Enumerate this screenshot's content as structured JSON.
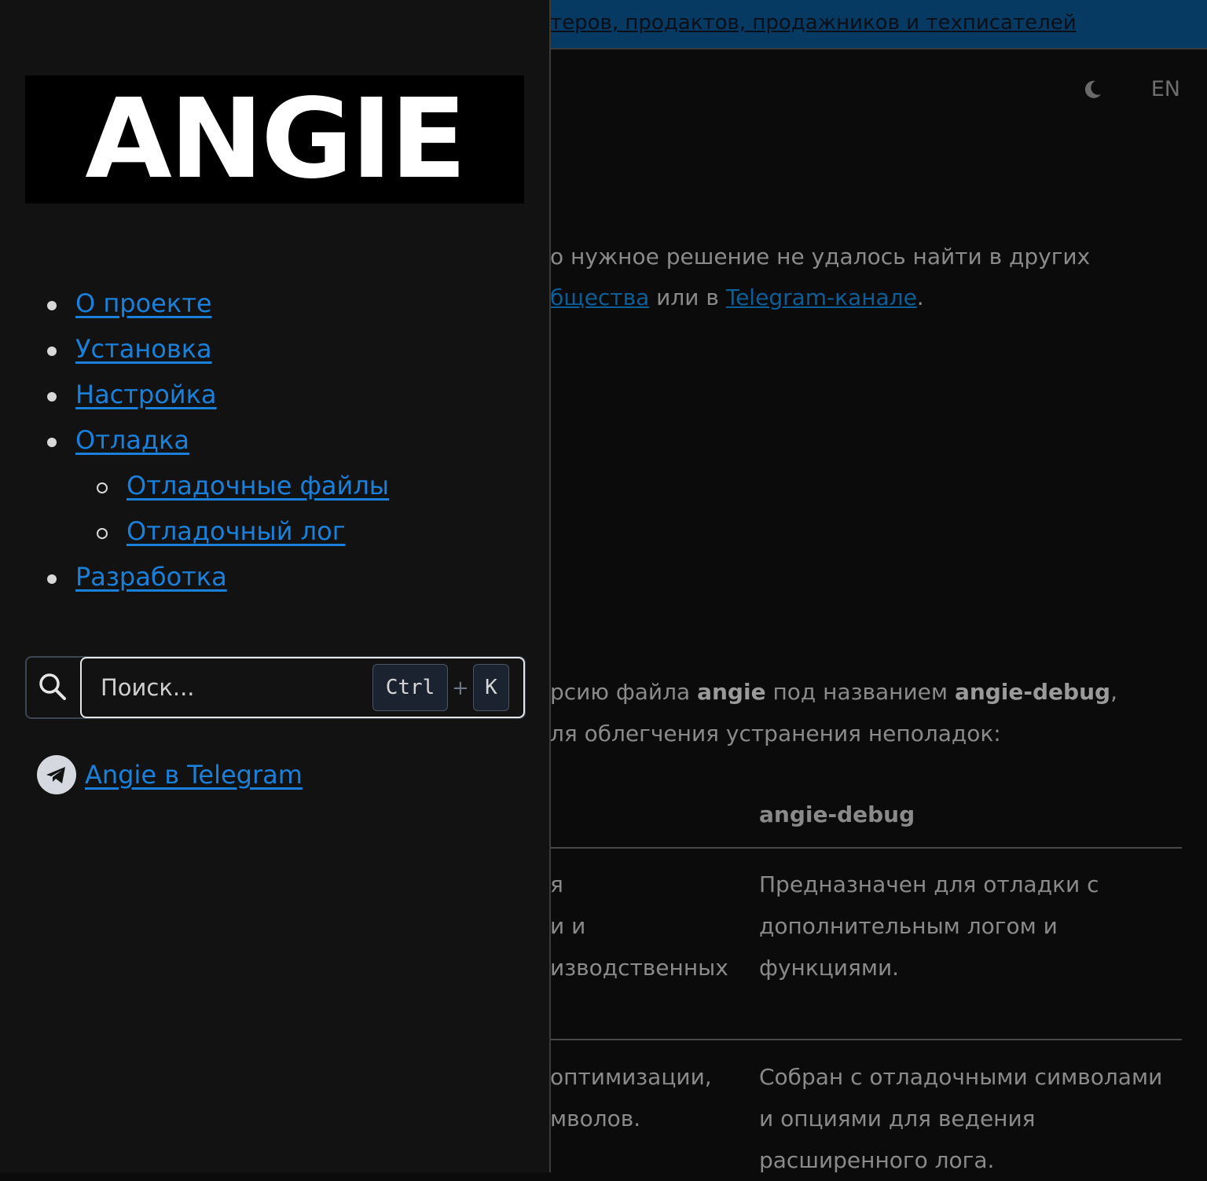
{
  "banner": {
    "text": "теров, продактов, продажников и техписателей"
  },
  "header": {
    "theme_icon": "moon-icon",
    "lang": "EN"
  },
  "background": {
    "para1_line1": "о нужное решение не удалось найти в других",
    "para1_line2_link1": "бщества",
    "para1_line2_mid": " или в ",
    "para1_line2_link2": "Telegram-канале",
    "para1_line2_end": ".",
    "para2_line1_a": "рсию файла ",
    "para2_line1_b": "angie",
    "para2_line1_c": " под названием ",
    "para2_line1_d": "angie-debug",
    "para2_line1_e": ",",
    "para2_line2": "ля облегчения устранения неполадок:",
    "table_head": "angie-debug",
    "row1_left": [
      "я",
      "и и",
      "изводственных"
    ],
    "row1_right": [
      "Предназначен для отладки с",
      "дополнительным логом и",
      "функциями."
    ],
    "row2_left": [
      "оптимизации,",
      "мволов."
    ],
    "row2_right": [
      "Собран с отладочными символами",
      "и опциями для ведения",
      "расширенного лога."
    ]
  },
  "drawer": {
    "logo_text": "ANGIE",
    "nav": [
      {
        "label": "О проекте"
      },
      {
        "label": "Установка"
      },
      {
        "label": "Настройка"
      },
      {
        "label": "Отладка"
      },
      {
        "label": "Отладочные файлы"
      },
      {
        "label": "Отладочный лог"
      },
      {
        "label": "Разработка"
      }
    ],
    "search": {
      "icon": "search-icon",
      "placeholder": "Поиск...",
      "kbd_ctrl": "Ctrl",
      "kbd_plus": "+",
      "kbd_k": "K"
    },
    "telegram": {
      "icon": "telegram-icon",
      "label": "Angie в Telegram"
    }
  },
  "colors": {
    "link": "#1a80d9",
    "banner": "#063a63",
    "drawer_bg": "#121212",
    "page_bg": "#0b0b0b"
  }
}
